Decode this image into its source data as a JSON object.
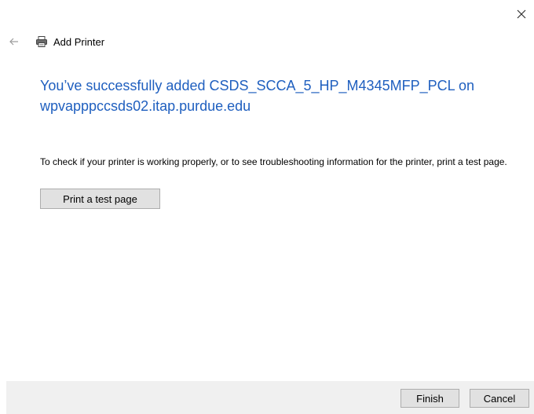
{
  "window": {
    "title": "Add Printer",
    "close_icon": "close-icon",
    "back_icon": "back-arrow-icon",
    "app_icon": "printer-icon"
  },
  "main": {
    "headline": "You’ve successfully added CSDS_SCCA_5_HP_M4345MFP_PCL on wpvapppccsds02.itap.purdue.edu",
    "info": "To check if your printer is working properly, or to see troubleshooting information for the printer, print a test page.",
    "test_button_label": "Print a test page"
  },
  "footer": {
    "finish_label": "Finish",
    "cancel_label": "Cancel"
  },
  "colors": {
    "headline": "#1f5fbf",
    "footer_bg": "#f0f0f0",
    "button_bg": "#e1e1e1",
    "button_border": "#adadad"
  }
}
